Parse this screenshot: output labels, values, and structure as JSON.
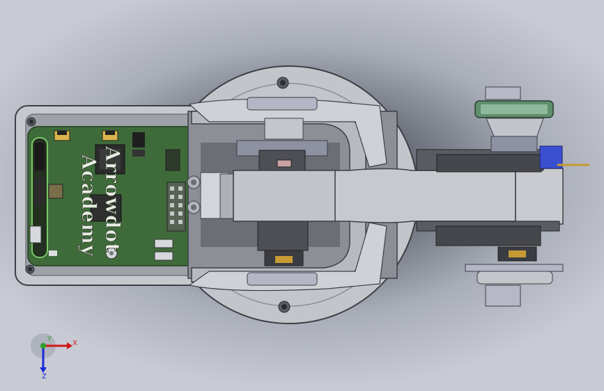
{
  "watermark": {
    "line1": "Arrowdot",
    "line2": "Academy"
  },
  "triad": {
    "x_label": "X",
    "y_label": "Y",
    "z_label": "Z"
  },
  "colors": {
    "background": "#a9adb8",
    "pcb": "#3f6b3a",
    "housing": "#c9cbd0",
    "green_ring": "#5f8f6c",
    "blue_block": "#3a4fd0",
    "x_axis": "#d01818",
    "y_axis": "#2aa02a",
    "z_axis": "#1a2ad8"
  }
}
